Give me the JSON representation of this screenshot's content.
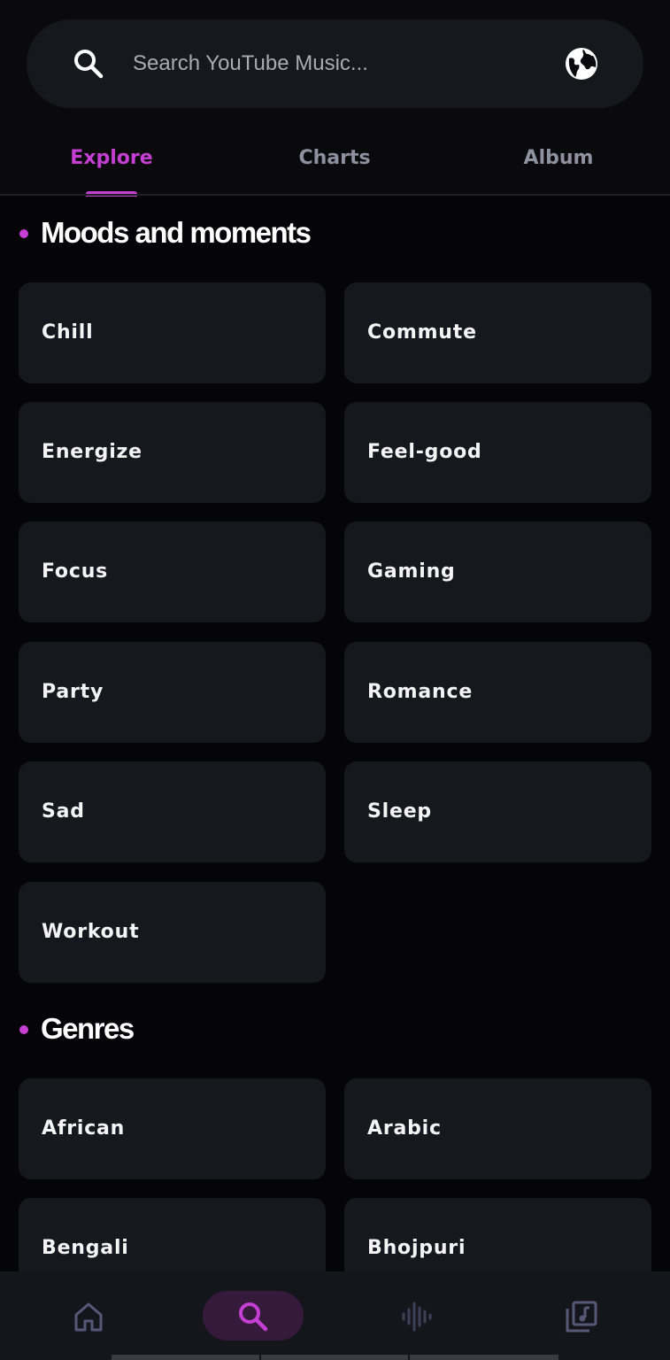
{
  "search": {
    "placeholder": "Search YouTube Music...",
    "icon": "search-icon",
    "region_icon": "globe-icon"
  },
  "tabs": [
    {
      "label": "Explore",
      "active": true
    },
    {
      "label": "Charts",
      "active": false
    },
    {
      "label": "Album",
      "active": false
    }
  ],
  "sections": {
    "moods": {
      "title": "Moods and moments",
      "items": [
        "Chill",
        "Commute",
        "Energize",
        "Feel-good",
        "Focus",
        "Gaming",
        "Party",
        "Romance",
        "Sad",
        "Sleep",
        "Workout"
      ]
    },
    "genres": {
      "title": "Genres",
      "items": [
        "African",
        "Arabic",
        "Bengali",
        "Bhojpuri"
      ]
    }
  },
  "bottom_nav": [
    {
      "icon": "home-icon",
      "active": false
    },
    {
      "icon": "search-icon",
      "active": true
    },
    {
      "icon": "waveform-icon",
      "active": false
    },
    {
      "icon": "library-music-icon",
      "active": false
    }
  ],
  "colors": {
    "accent": "#c53fd2",
    "background": "#050507",
    "tile": "#17181d",
    "nav_active_pill": "#361a3c"
  }
}
